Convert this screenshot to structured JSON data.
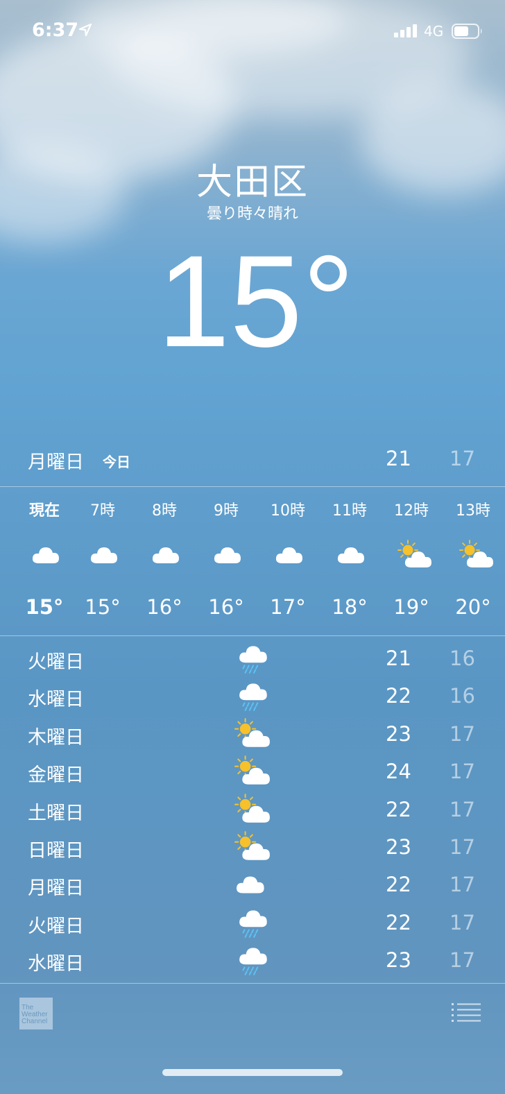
{
  "status": {
    "time": "6:37",
    "network": "4G"
  },
  "header": {
    "city": "大田区",
    "condition": "曇り時々晴れ",
    "temperature": "15°"
  },
  "today": {
    "day": "月曜日",
    "label": "今日",
    "high": "21",
    "low": "17"
  },
  "hourly": [
    {
      "label": "現在",
      "icon": "cloud-icon",
      "temp": "15°"
    },
    {
      "label": "7時",
      "icon": "cloud-icon",
      "temp": "15°"
    },
    {
      "label": "8時",
      "icon": "cloud-icon",
      "temp": "16°"
    },
    {
      "label": "9時",
      "icon": "cloud-icon",
      "temp": "16°"
    },
    {
      "label": "10時",
      "icon": "cloud-icon",
      "temp": "17°"
    },
    {
      "label": "11時",
      "icon": "cloud-icon",
      "temp": "18°"
    },
    {
      "label": "12時",
      "icon": "partly-sunny-icon",
      "temp": "19°"
    },
    {
      "label": "13時",
      "icon": "partly-sunny-icon",
      "temp": "20°"
    }
  ],
  "daily": [
    {
      "day": "火曜日",
      "icon": "rain-icon",
      "high": "21",
      "low": "16"
    },
    {
      "day": "水曜日",
      "icon": "rain-icon",
      "high": "22",
      "low": "16"
    },
    {
      "day": "木曜日",
      "icon": "partly-sunny-icon",
      "high": "23",
      "low": "17"
    },
    {
      "day": "金曜日",
      "icon": "partly-sunny-icon",
      "high": "24",
      "low": "17"
    },
    {
      "day": "土曜日",
      "icon": "partly-sunny-icon",
      "high": "22",
      "low": "17"
    },
    {
      "day": "日曜日",
      "icon": "partly-sunny-icon",
      "high": "23",
      "low": "17"
    },
    {
      "day": "月曜日",
      "icon": "cloud-icon",
      "high": "22",
      "low": "17"
    },
    {
      "day": "火曜日",
      "icon": "rain-icon",
      "high": "22",
      "low": "17"
    },
    {
      "day": "水曜日",
      "icon": "rain-icon",
      "high": "23",
      "low": "17"
    }
  ],
  "footer": {
    "logo_text": "The Weather Channel"
  },
  "colors": {
    "sun": "#f6c12a",
    "rain": "#5cc1f2",
    "cloud": "#ffffff"
  }
}
